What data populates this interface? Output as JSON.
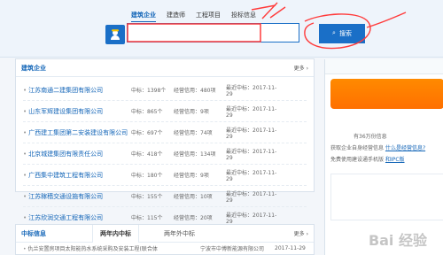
{
  "search_tabs": [
    {
      "label": "建筑企业",
      "active": true
    },
    {
      "label": "建造师",
      "active": false
    },
    {
      "label": "工程项目",
      "active": false
    },
    {
      "label": "投标信息",
      "active": false
    }
  ],
  "search": {
    "placeholder": "",
    "button_label": "搜索"
  },
  "company_panel": {
    "title": "建筑企业",
    "more": "更多",
    "rows": [
      {
        "name": "江苏南通二建集团有限公司",
        "bid": "中标：1398个",
        "license": "经营信用：480项",
        "date": "最近中标：2017-11-29"
      },
      {
        "name": "山东军辉建设集团有限公司",
        "bid": "中标：865个",
        "license": "经营信用：9项",
        "date": "最近中标：2017-11-29"
      },
      {
        "name": "广西建工集团第二安装建设有限公司",
        "bid": "中标：697个",
        "license": "经营信用：74项",
        "date": "最近中标：2017-11-29"
      },
      {
        "name": "北京城建集团有限责任公司",
        "bid": "中标：418个",
        "license": "经营信用：134项",
        "date": "最近中标：2017-11-29"
      },
      {
        "name": "广西集中建筑工程有限公司",
        "bid": "中标：180个",
        "license": "经营信用：9项",
        "date": "最近中标：2017-11-29"
      },
      {
        "name": "江苏稼穑交通设施有限公司",
        "bid": "中标：155个",
        "license": "经营信用：10项",
        "date": "最近中标：2017-11-29"
      },
      {
        "name": "江苏欣润交通工程有限公司",
        "bid": "中标：115个",
        "license": "经营信用：20项",
        "date": "最近中标：2017-11-29"
      }
    ]
  },
  "bid_panel": {
    "title": "中标信息",
    "tab1": "两年内中标",
    "tab2": "两年外中标",
    "more": "更多",
    "rows": [
      {
        "name": "仇兰安置房项目太阳能热水系统采购及安装工程(联合体",
        "company": "宁波市中博新能源有限公司",
        "date": "2017-11-29"
      }
    ]
  },
  "right_panel": {
    "count_text": "有36万份信息",
    "line1_prefix": "获取企业自身经营信息",
    "line1_link": "什么是经营信息?",
    "line2_prefix": "免费使用建设通手机版",
    "line2_link": "和IPC版"
  },
  "watermark": "Bai 经验"
}
